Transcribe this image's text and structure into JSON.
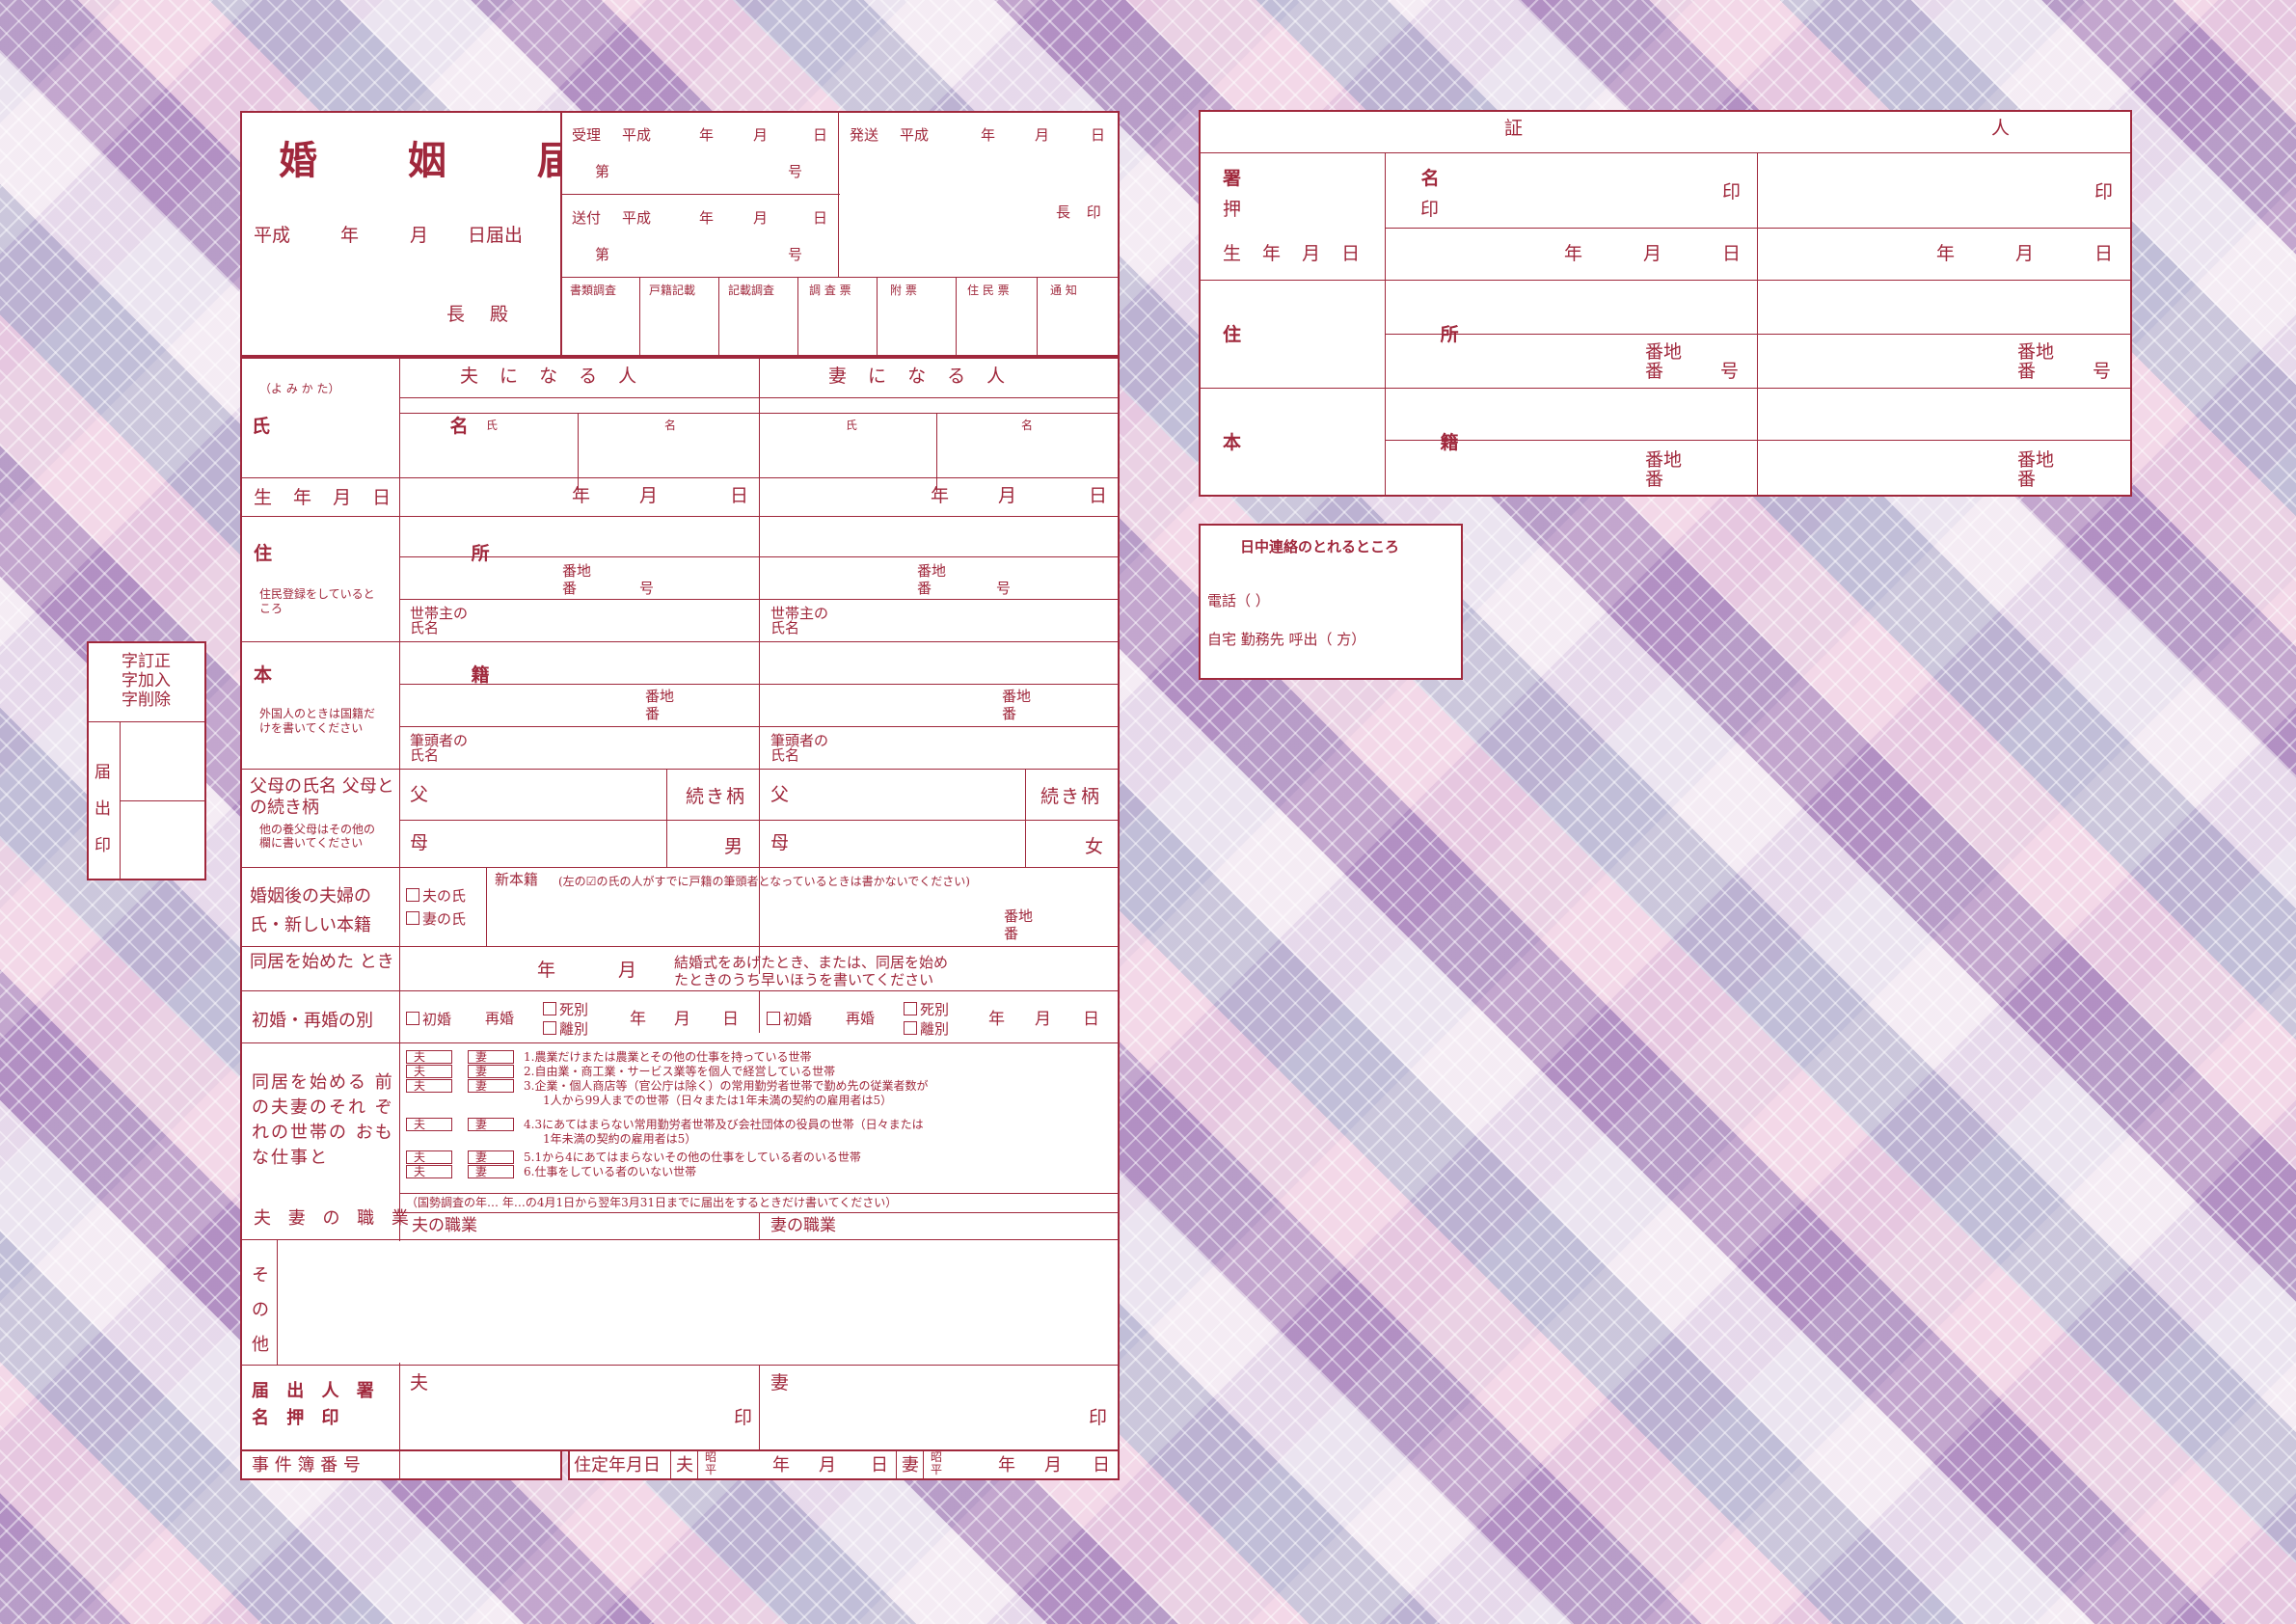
{
  "header": {
    "title": "婚 姻 届",
    "date_line": [
      "平成",
      "年",
      "月",
      "日届出"
    ],
    "chief": "長 殿",
    "received": {
      "label": "受理",
      "era": "平成",
      "y": "年",
      "m": "月",
      "d": "日",
      "no": "第",
      "go": "号"
    },
    "sent": {
      "label": "送付",
      "era": "平成",
      "y": "年",
      "m": "月",
      "d": "日",
      "no": "第",
      "go": "号"
    },
    "dispatch": {
      "label": "発送",
      "era": "平成",
      "y": "年",
      "m": "月",
      "d": "日",
      "chief": "長 印"
    },
    "office_cols": [
      "書類調査",
      "戸籍記載",
      "記載調査",
      "調 査 票",
      "附 票",
      "住 民 票",
      "通 知"
    ]
  },
  "persons": {
    "husband": "夫 に な る 人",
    "wife": "妻 に な る 人"
  },
  "labels": {
    "yomi": "（よ み か た）",
    "name": "氏 名",
    "shi": "氏",
    "mei": "名",
    "dob": "生 年 月 日",
    "ymd": [
      "年",
      "月",
      "日"
    ],
    "address": "住 所",
    "address_note": "住民登録をしているところ",
    "banchi": "番地",
    "ban": "番",
    "go": "号",
    "householder": "世帯主の氏名",
    "honseki": "本 籍",
    "honseki_note": "外国人のときは国籍だけを書いてください",
    "head": "筆頭者の氏名",
    "parents": "父母の氏名 父母との続き柄",
    "parents_note": "他の養父母はその他の欄に書いてください",
    "father": "父",
    "mother": "母",
    "relation": "続き柄",
    "son": "男",
    "daughter": "女",
    "new_family": "婚姻後の夫婦の 氏・新しい本籍",
    "opt_husband": "夫の氏",
    "opt_wife": "妻の氏",
    "new_honseki": "新本籍",
    "new_honseki_note": "(左の☑の氏の人がすでに戸籍の筆頭者となっているときは書かないでください)",
    "cohabit": "同居を始めた とき",
    "cohabit_ym": [
      "年",
      "月"
    ],
    "cohabit_note": [
      "結婚式をあげたとき、または、同居を始め",
      "たときのうち早いほうを書いてください"
    ],
    "marriage_kind": "初婚・再婚の別",
    "first": "初婚",
    "re": "再婚",
    "death": "死別",
    "divorce": "離別",
    "work_title": "同居を始める 前の夫妻のそれ ぞれの世帯の おもな仕事と",
    "job_title": "夫 妻 の 職 業",
    "tag_h": "夫",
    "tag_w": "妻",
    "work_items": [
      "1.農業だけまたは農業とその他の仕事を持っている世帯",
      "2.自由業・商工業・サービス業等を個人で経営している世帯",
      "3.企業・個人商店等（官公庁は除く）の常用勤労者世帯で勤め先の従業者数が",
      "1人から99人までの世帯（日々または1年未満の契約の雇用者は5）",
      "4.3にあてはまらない常用勤労者世帯及び会社団体の役員の世帯（日々または",
      "1年未満の契約の雇用者は5）",
      "5.1から4にあてはまらないその他の仕事をしている者のいる世帯",
      "6.仕事をしている者のいない世帯"
    ],
    "census_note": "（国勢調査の年… 年…の4月1日から翌年3月31日までに届出をするときだけ書いてください）",
    "h_job": "夫の職業",
    "w_job": "妻の職業",
    "other": "そ の 他",
    "signer": "届 出 人 署 名 押 印",
    "h": "夫",
    "w": "妻",
    "seal": "印",
    "case_no": "事 件 簿 番 号",
    "resident_date": "住定年月日",
    "showa": "昭平"
  },
  "side": {
    "top": "字訂正 字加入 字削除",
    "bottom": "届 出 印"
  },
  "witness": {
    "title": "証 人",
    "sign": "署 名",
    "seal_label": "押 印",
    "seal": "印",
    "dob": "生 年 月 日",
    "ymd": [
      "年",
      "月",
      "日"
    ],
    "address": "住 所",
    "banchi": "番地",
    "ban": "番",
    "go": "号",
    "honseki": "本 籍"
  },
  "contact": {
    "title": "日中連絡のとれるところ",
    "tel": "電話（ ）",
    "line2": "自宅 勤務先 呼出（ 方）"
  }
}
